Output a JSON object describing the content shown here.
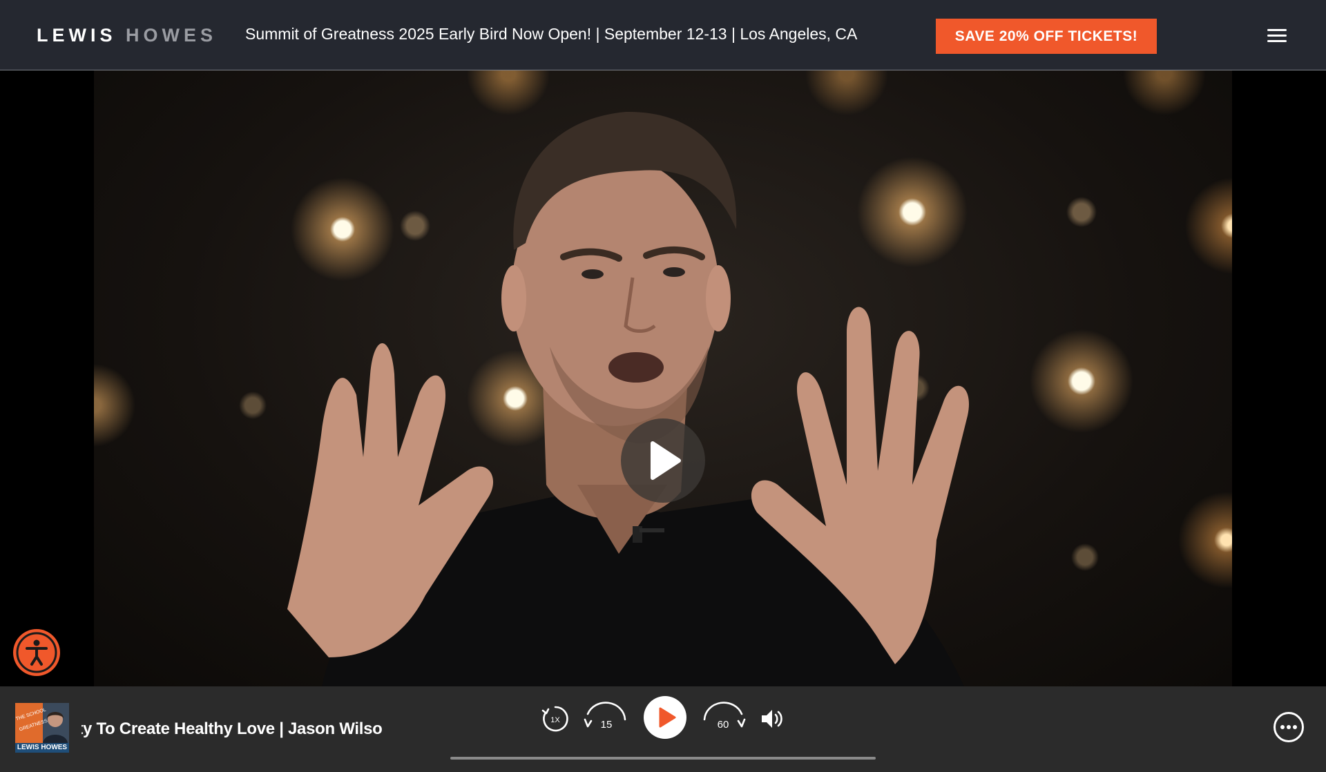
{
  "header": {
    "logo_first": "LEWIS",
    "logo_second": "HOWES",
    "announcement": "Summit of Greatness 2025 Early Bird Now Open! | September 12-13 | Los Angeles, CA",
    "cta_label": "SAVE 20% OFF TICKETS!",
    "menu_icon": "hamburger-menu-icon"
  },
  "video": {
    "state": "paused",
    "play_icon": "play-icon"
  },
  "accessibility": {
    "icon": "accessibility-person-icon"
  },
  "player": {
    "cover_label": "LEWIS HOWES",
    "episode_title": "ity To Create Healthy Love | Jason Wilso",
    "speed_label": "1X",
    "rewind_label": "15",
    "forward_label": "60",
    "progress": 0,
    "more_icon": "more-options-icon"
  },
  "colors": {
    "header_bg": "#252830",
    "accent": "#f0582b",
    "player_bg": "#2b2b2b"
  }
}
